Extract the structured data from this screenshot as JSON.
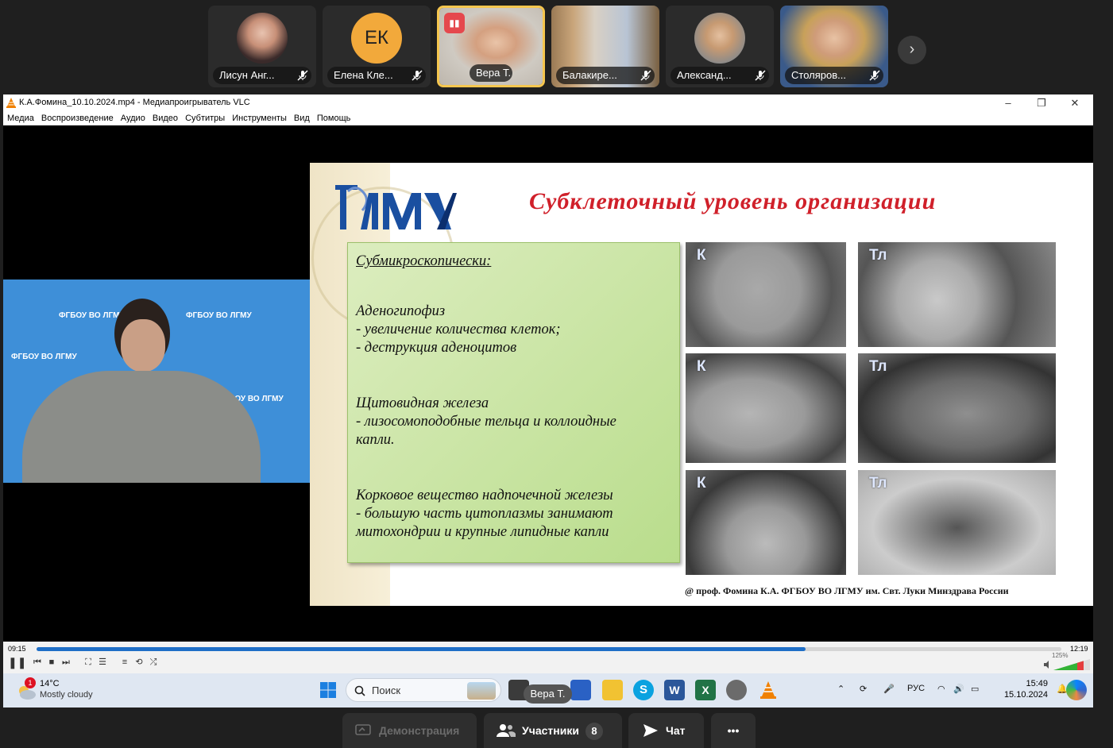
{
  "participants": [
    {
      "name": "Лисун Анг...",
      "type": "photo",
      "muted": true
    },
    {
      "name": "Елена Кле...",
      "initials": "ЕК",
      "type": "initials",
      "color": "#f2a93b",
      "muted": true
    },
    {
      "name": "Вера Т.",
      "type": "video",
      "active": true,
      "muted": false
    },
    {
      "name": "Балакире...",
      "type": "video",
      "muted": true
    },
    {
      "name": "Александ...",
      "type": "photo",
      "muted": true
    },
    {
      "name": "Столяров...",
      "type": "video",
      "muted": true
    }
  ],
  "vlc": {
    "title": "К.А.Фомина_10.10.2024.mp4 - Медиапроигрыватель VLC",
    "menu": [
      "Медиа",
      "Воспроизведение",
      "Аудио",
      "Видео",
      "Субтитры",
      "Инструменты",
      "Вид",
      "Помощь"
    ],
    "time_current": "09:15",
    "time_total": "12:19",
    "progress": 0.75,
    "volume_label": "125%"
  },
  "slide": {
    "logo_text": "ЛГМУ",
    "title": "Субклеточный уровень организации",
    "heading": "Субмикроскопически:",
    "p1_title": "Аденогипофиз",
    "p1_line1": "- увеличение количества клеток;",
    "p1_line2": "- деструкция аденоцитов",
    "p2_title": "Щитовидная железа",
    "p2_line1": "- лизосомоподобные тельца и коллоидные",
    "p2_line2": "капли.",
    "p3_title": "Корковое вещество надпочечной железы",
    "p3_line1": "- большую часть цитоплазмы занимают",
    "p3_line2": "митохондрии и крупные липидные капли",
    "micro_labels": [
      "К",
      "Тл",
      "К",
      "Тл",
      "К",
      "Тл"
    ],
    "credit": "@ проф. Фомина К.А. ФГБОУ ВО ЛГМУ им. Свт. Луки Минздрава России"
  },
  "speaker_backdrop": "ФГБОУ ВО ЛГМУ",
  "taskbar": {
    "weather_temp": "14°C",
    "weather_desc": "Mostly cloudy",
    "weather_badge": "1",
    "search_placeholder": "Поиск",
    "lang": "РУС",
    "time": "15:49",
    "date": "15.10.2024"
  },
  "speaker_tag": "Вера Т.",
  "toolbar": {
    "demo_label": "Демонстрация",
    "participants_label": "Участники",
    "participants_count": "8",
    "chat_label": "Чат",
    "more_label": "•••"
  }
}
